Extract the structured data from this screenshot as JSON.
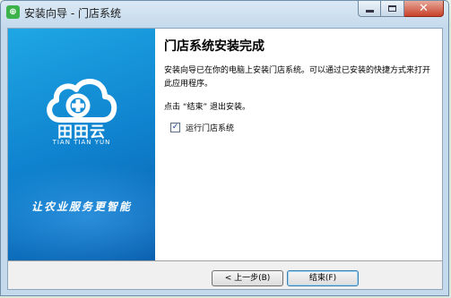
{
  "window": {
    "title": "安装向导 - 门店系统",
    "app_icon_glyph": "⊕"
  },
  "banner": {
    "brand_name": "田田云",
    "brand_pinyin": "TIAN TIAN YUN",
    "slogan": "让农业服务更智能",
    "gradient_top": "#1fa7e4",
    "gradient_bottom": "#0a5fae"
  },
  "page": {
    "heading": "门店系统安装完成",
    "description": "安装向导已在你的电脑上安装门店系统。可以通过已安装的快捷方式来打开此应用程序。",
    "hint": "点击 “结束” 退出安装。",
    "checkbox_label": "运行门店系统",
    "checkbox_checked": true,
    "checkbox_mark": "✓"
  },
  "buttons": {
    "back_label": "< 上一步(B)",
    "finish_label": "结束(F)"
  },
  "caption": {
    "close_glyph": "✕"
  }
}
